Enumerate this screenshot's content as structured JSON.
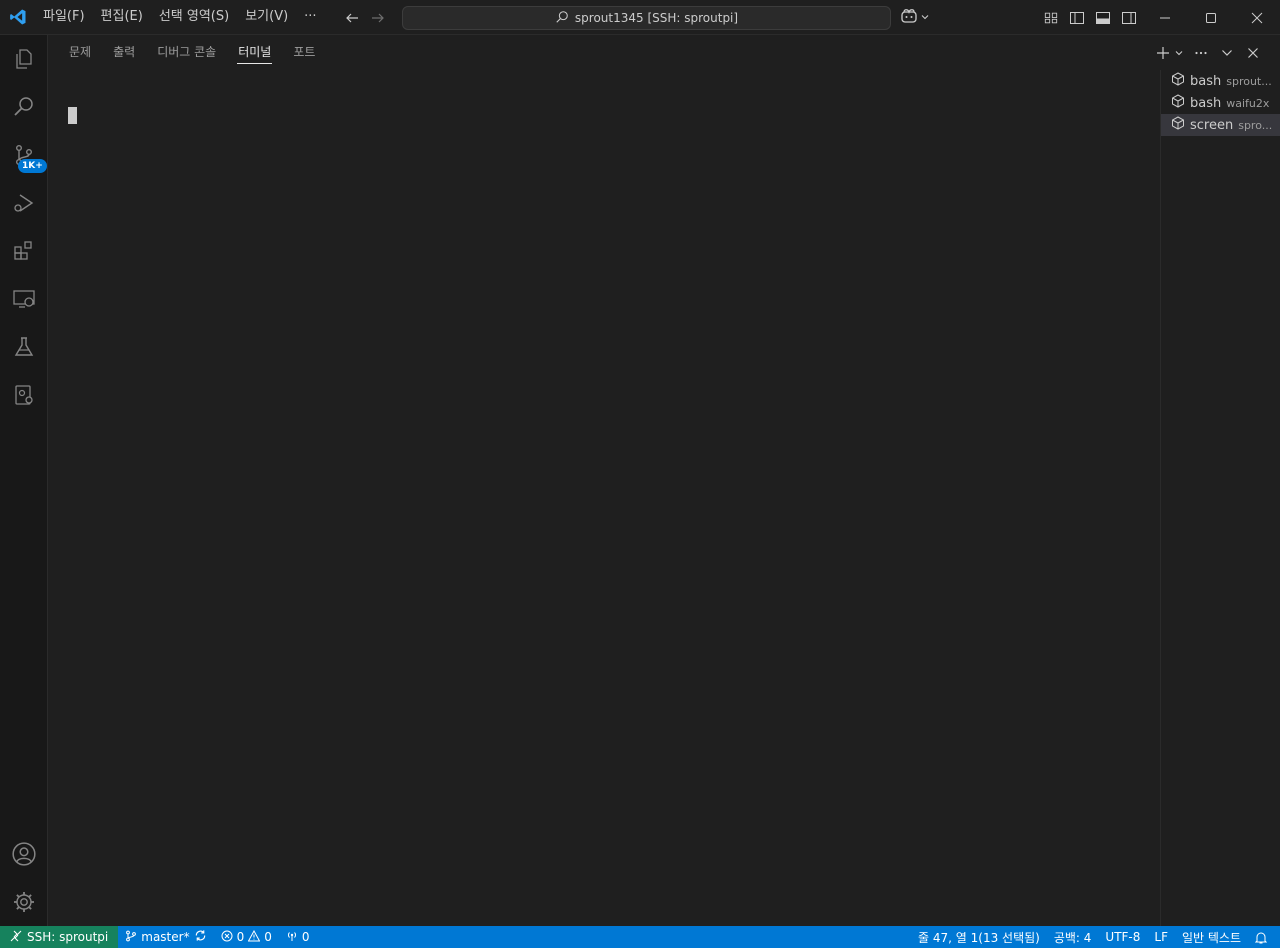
{
  "titlebar": {
    "logo_icon": "vscode-logo-icon",
    "menu": [
      "파일(F)",
      "편집(E)",
      "선택 영역(S)",
      "보기(V)",
      "···"
    ],
    "search_text": "sprout1345 [SSH: sproutpi]"
  },
  "activitybar": {
    "items": [
      {
        "name": "explorer-icon"
      },
      {
        "name": "search-icon"
      },
      {
        "name": "source-control-icon",
        "badge": "1K+"
      },
      {
        "name": "run-debug-icon"
      },
      {
        "name": "extensions-icon"
      },
      {
        "name": "remote-explorer-icon"
      },
      {
        "name": "testing-icon"
      },
      {
        "name": "docker-icon"
      }
    ],
    "bottom": [
      {
        "name": "account-icon"
      },
      {
        "name": "manage-gear-icon"
      }
    ]
  },
  "panel": {
    "tabs": [
      "문제",
      "출력",
      "디버그 콘솔",
      "터미널",
      "포트"
    ],
    "active_tab": 3,
    "terminals": [
      {
        "name": "bash",
        "desc": "sprout...",
        "selected": false
      },
      {
        "name": "bash",
        "desc": "waifu2x",
        "selected": false
      },
      {
        "name": "screen",
        "desc": "spro...",
        "selected": true
      }
    ]
  },
  "statusbar": {
    "remote": "SSH: sproutpi",
    "branch": "master*",
    "errors": "0",
    "warnings": "0",
    "ports": "0",
    "position": "줄 47, 열 1(13 선택됨)",
    "spaces": "공백: 4",
    "encoding": "UTF-8",
    "eol": "LF",
    "language": "일반 텍스트"
  },
  "colors": {
    "accent": "#0078d4",
    "remote": "#16825d",
    "background": "#1f1f1f"
  }
}
